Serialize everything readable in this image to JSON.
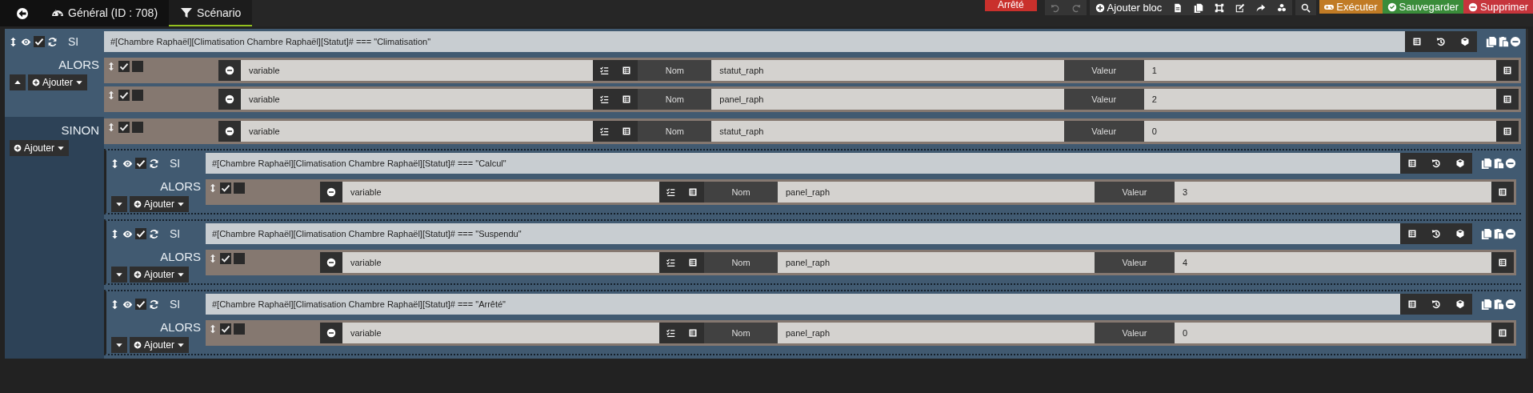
{
  "topbar": {
    "tabs": [
      {
        "kind": "general",
        "label": "Général (ID : 708)",
        "selected": false
      },
      {
        "kind": "scenario",
        "label": "Scénario",
        "selected": true
      }
    ],
    "state": "Arrêté",
    "add_block": "Ajouter bloc",
    "commands": [
      {
        "kind": "run",
        "label": "Exécuter"
      },
      {
        "kind": "save",
        "label": "Sauvegarder"
      },
      {
        "kind": "delete",
        "label": "Supprimer"
      }
    ]
  },
  "block": {
    "si": "SI",
    "enabled": true,
    "condition": "#[Chambre Raphaël][Climatisation Chambre Raphaël][Statut]# === \"Climatisation\"",
    "alors": "ALORS",
    "caret_up": true,
    "add": "Ajouter",
    "then": [
      {
        "kind": "action",
        "enabled": true,
        "parallel": false,
        "type": "variable",
        "name_label": "Nom",
        "name": "statut_raph",
        "value_label": "Valeur",
        "value": "1"
      },
      {
        "kind": "action",
        "enabled": true,
        "parallel": false,
        "type": "variable",
        "name_label": "Nom",
        "name": "panel_raph",
        "value_label": "Valeur",
        "value": "2"
      }
    ],
    "sinon": "SINON",
    "sinon_add": "Ajouter",
    "else": [
      {
        "kind": "action",
        "enabled": true,
        "parallel": false,
        "type": "variable",
        "name_label": "Nom",
        "name": "statut_raph",
        "value_label": "Valeur",
        "value": "0"
      },
      {
        "kind": "block",
        "si": "SI",
        "enabled": true,
        "condition": "#[Chambre Raphaël][Climatisation Chambre Raphaël][Statut]# === \"Calcul\"",
        "alors": "ALORS",
        "caret_up": false,
        "add": "Ajouter",
        "then": [
          {
            "kind": "action",
            "enabled": true,
            "parallel": false,
            "type": "variable",
            "name_label": "Nom",
            "name": "panel_raph",
            "value_label": "Valeur",
            "value": "3"
          }
        ]
      },
      {
        "kind": "block",
        "si": "SI",
        "enabled": true,
        "condition": "#[Chambre Raphaël][Climatisation Chambre Raphaël][Statut]# === \"Suspendu\"",
        "alors": "ALORS",
        "caret_up": false,
        "add": "Ajouter",
        "then": [
          {
            "kind": "action",
            "enabled": true,
            "parallel": false,
            "type": "variable",
            "name_label": "Nom",
            "name": "panel_raph",
            "value_label": "Valeur",
            "value": "4"
          }
        ]
      },
      {
        "kind": "block",
        "si": "SI",
        "enabled": true,
        "condition": "#[Chambre Raphaël][Climatisation Chambre Raphaël][Statut]# === \"Arrêté\"",
        "alors": "ALORS",
        "caret_up": false,
        "add": "Ajouter",
        "then": [
          {
            "kind": "action",
            "enabled": true,
            "parallel": false,
            "type": "variable",
            "name_label": "Nom",
            "name": "panel_raph",
            "value_label": "Valeur",
            "value": "0"
          }
        ]
      }
    ]
  }
}
